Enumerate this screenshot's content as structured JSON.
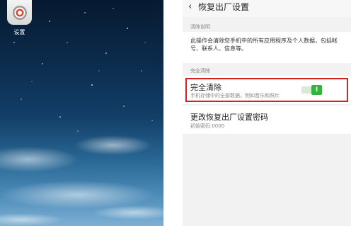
{
  "home": {
    "app_label": "设置"
  },
  "settings": {
    "title": "恢复出厂设置",
    "section_clear_info": "清除说明",
    "description": "此操作会清除您手机中的所有应用程序及个人数据，包括帐号、联系人、信息等。",
    "section_full_clear": "完全清除",
    "full_clear": {
      "title": "完全清除",
      "subtitle": "手机存储中的全部数据，例如音乐和照片",
      "toggle_state": "on",
      "toggle_glyph": "I"
    },
    "change_password": {
      "title": "更改恢复出厂设置密码",
      "subtitle": "初始密码:0000"
    }
  },
  "colors": {
    "accent_green": "#33b53c",
    "highlight_red": "#d22222"
  }
}
